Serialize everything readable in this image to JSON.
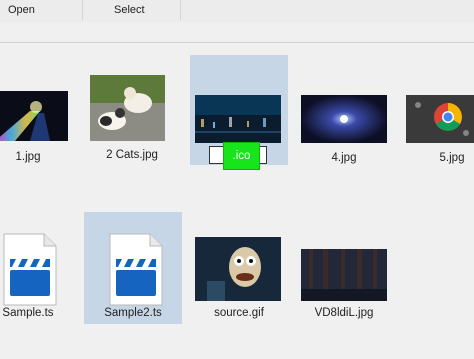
{
  "toolbar": {
    "open_label": "Open",
    "select_label": "Select"
  },
  "files": {
    "row1": [
      {
        "name": "1.jpg"
      },
      {
        "name": "2 Cats.jpg"
      },
      {
        "name": ""
      },
      {
        "name": "4.jpg"
      },
      {
        "name": "5.jpg"
      }
    ],
    "row2": [
      {
        "name": "Sample.ts"
      },
      {
        "name": "Sample2.ts"
      },
      {
        "name": "source.gif"
      },
      {
        "name": "VD8ldiL.jpg"
      }
    ]
  },
  "rename": {
    "value": ".ico"
  },
  "colors": {
    "selection": "#c7d6e6",
    "highlight": "#18e41b",
    "clapper_blue": "#1565c0"
  }
}
